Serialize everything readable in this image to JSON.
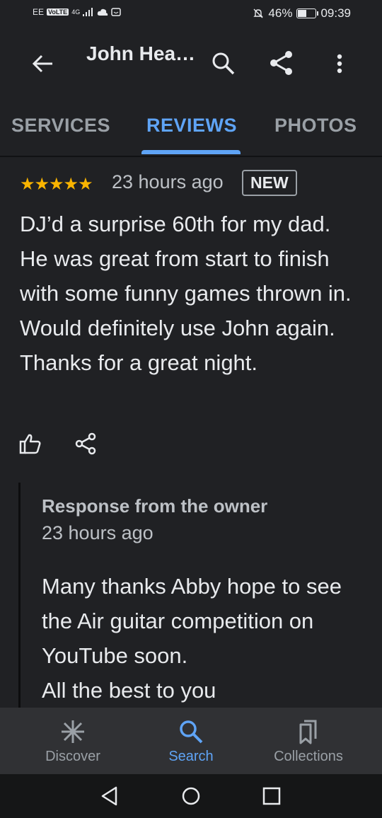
{
  "status_bar": {
    "carrier": "EE",
    "volte": "VoLTE",
    "network": "4G",
    "battery": "46%",
    "battery_level": 0.46,
    "time": "09:39"
  },
  "app_bar": {
    "title": "John Hea…"
  },
  "tabs": [
    {
      "label": "SERVICES",
      "active": false
    },
    {
      "label": "REVIEWS",
      "active": true
    },
    {
      "label": "PHOTOS",
      "active": false
    }
  ],
  "review": {
    "rating": 5,
    "stars": "★★★★★",
    "time": "23 hours ago",
    "badge": "NEW",
    "text": "DJ’d a surprise 60th for my dad. He was great from start to finish with some funny games thrown in. Would definitely use John again. Thanks for a great night.",
    "owner_response": {
      "title": "Response from the owner",
      "time": "23 hours ago",
      "text": "Many thanks Abby hope to see the Air guitar competition on YouTube soon.\nAll the best to you"
    }
  },
  "bottom_nav": [
    {
      "label": "Discover",
      "icon": "asterisk-icon",
      "active": false
    },
    {
      "label": "Search",
      "icon": "search-icon",
      "active": true
    },
    {
      "label": "Collections",
      "icon": "bookmarks-icon",
      "active": false
    }
  ],
  "colors": {
    "background": "#202124",
    "accent": "#5fa4f6",
    "star": "#f9b400",
    "nav_background": "#303134"
  }
}
